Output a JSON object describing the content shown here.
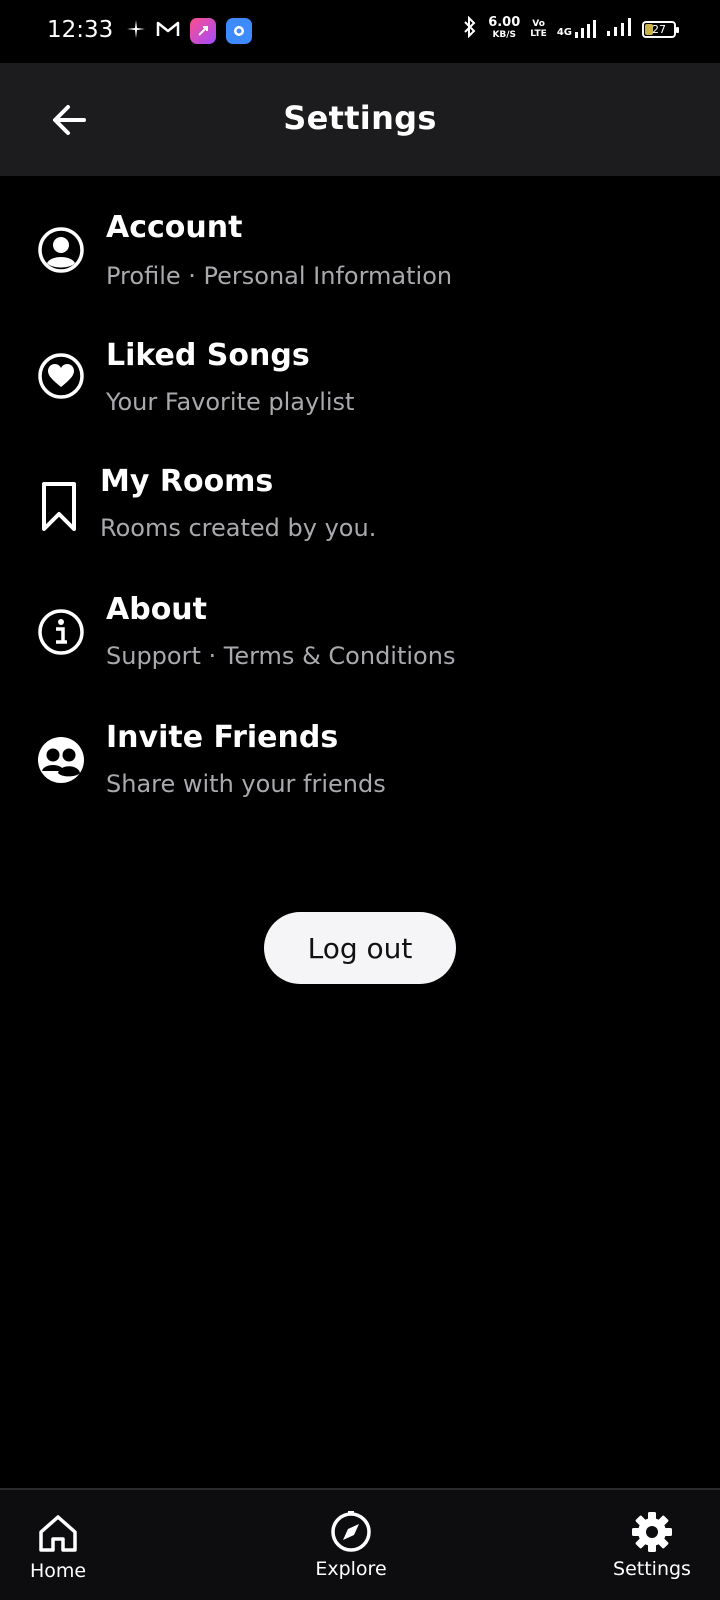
{
  "status_bar": {
    "time": "12:33",
    "speed_value": "6.00",
    "speed_unit": "KB/S",
    "volte_top": "Vo",
    "volte_bottom": "LTE",
    "network": "4G",
    "battery": "27"
  },
  "header": {
    "title": "Settings"
  },
  "menu": {
    "items": [
      {
        "title": "Account",
        "subtitle": "Profile · Personal Information",
        "icon": "account-circle-icon"
      },
      {
        "title": "Liked Songs",
        "subtitle": "Your Favorite playlist",
        "icon": "heart-circle-icon"
      },
      {
        "title": "My Rooms",
        "subtitle": "Rooms created by you.",
        "icon": "bookmark-icon"
      },
      {
        "title": "About",
        "subtitle": "Support · Terms & Conditions",
        "icon": "info-icon"
      },
      {
        "title": "Invite Friends",
        "subtitle": "Share with your friends",
        "icon": "friends-icon"
      }
    ]
  },
  "logout": {
    "label": "Log out"
  },
  "bottom_nav": {
    "items": [
      {
        "label": "Home",
        "icon": "home-icon"
      },
      {
        "label": "Explore",
        "icon": "compass-icon"
      },
      {
        "label": "Settings",
        "icon": "gear-icon"
      }
    ]
  },
  "colors": {
    "background": "#000000",
    "app_bar": "#1c1c1e",
    "subtitle": "#a9a9ae",
    "button_bg": "#f5f5f7"
  }
}
